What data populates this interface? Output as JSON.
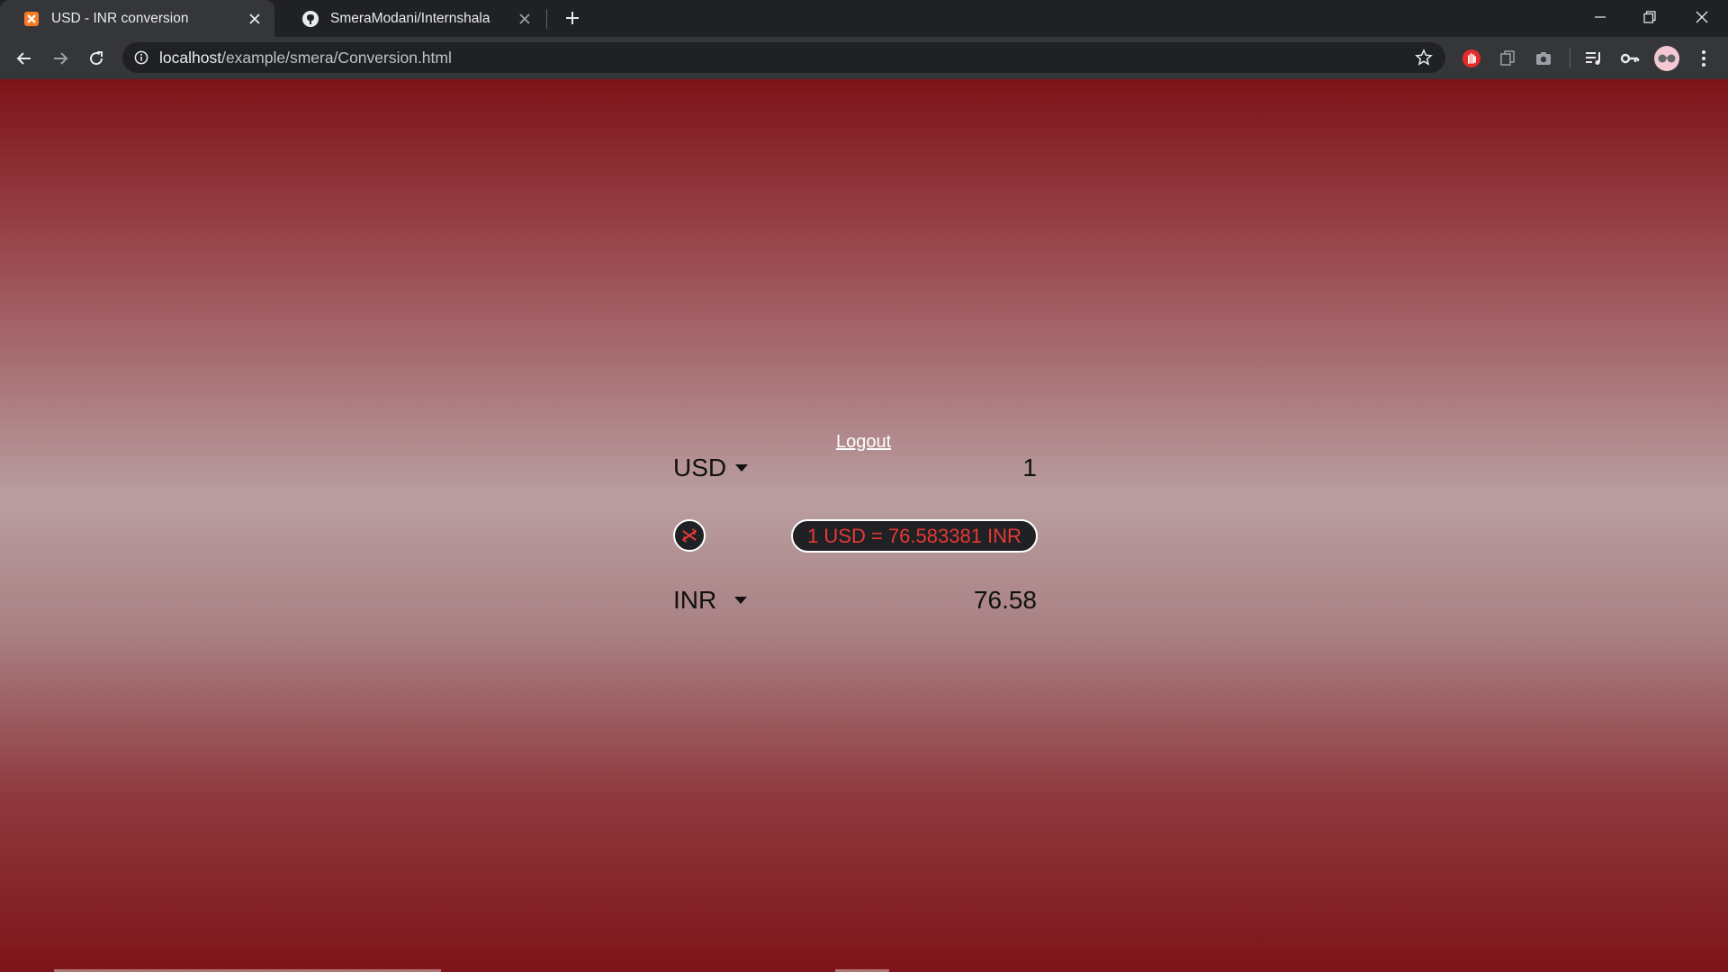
{
  "browser": {
    "tabs": [
      {
        "title": "USD - INR conversion",
        "active": true,
        "favicon": "xampp-icon"
      },
      {
        "title": "SmeraModani/Internshala",
        "active": false,
        "favicon": "github-icon"
      }
    ],
    "url_host": "localhost",
    "url_path": "/example/smera/Conversion.html"
  },
  "page": {
    "logout_label": "Logout",
    "from_currency": "USD",
    "from_amount": "1",
    "to_currency": "INR",
    "to_amount": "76.58",
    "rate_text": "1 USD = 76.583381 INR"
  },
  "colors": {
    "gradient_edge": "#7d1318",
    "gradient_center": "#b99ea0",
    "rate_text": "#e53935",
    "pill_bg": "#202124"
  }
}
